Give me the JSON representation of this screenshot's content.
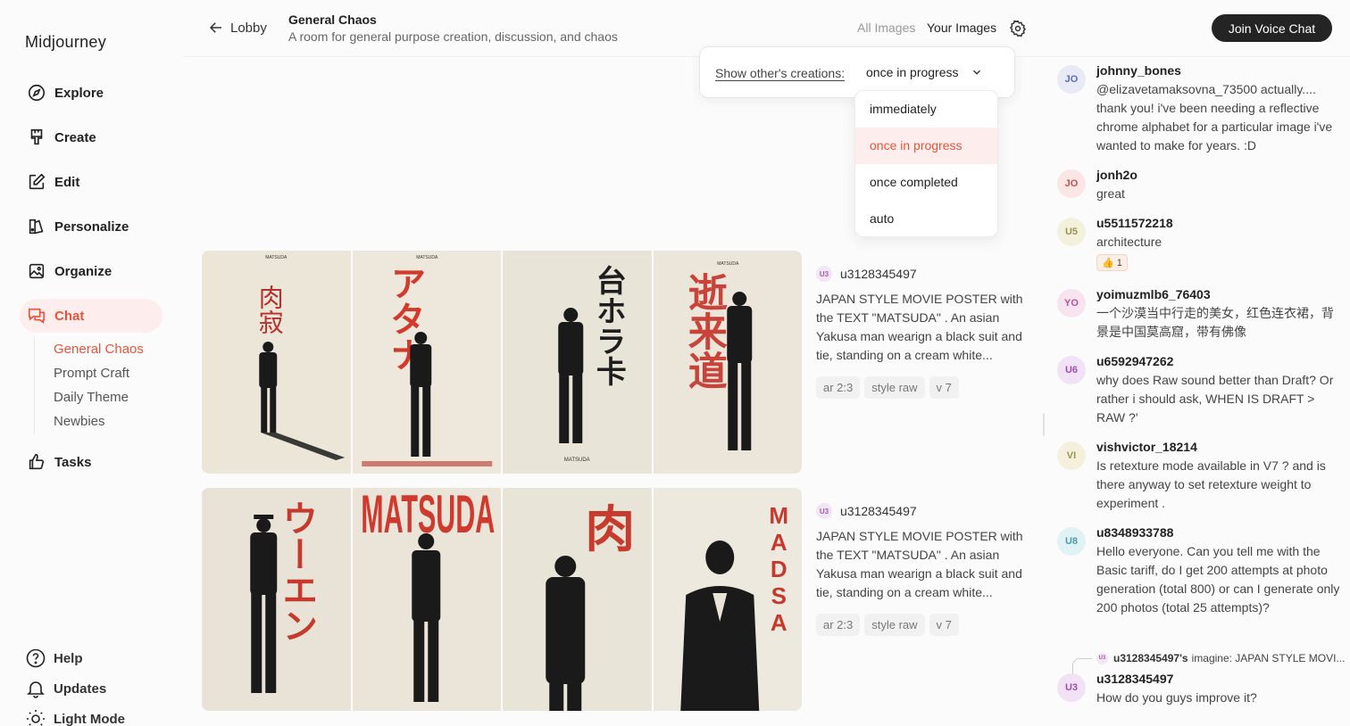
{
  "brand": "Midjourney",
  "nav": {
    "explore": "Explore",
    "create": "Create",
    "edit": "Edit",
    "personalize": "Personalize",
    "organize": "Organize",
    "chat": "Chat",
    "tasks": "Tasks"
  },
  "rooms": [
    "General Chaos",
    "Prompt Craft",
    "Daily Theme",
    "Newbies"
  ],
  "footer": {
    "help": "Help",
    "updates": "Updates",
    "light_mode": "Light Mode"
  },
  "header": {
    "back": "Lobby",
    "title": "General Chaos",
    "description": "A room for general purpose creation, discussion, and chaos",
    "all_images": "All Images",
    "your_images": "Your Images",
    "join": "Join Voice Chat"
  },
  "popover": {
    "label": "Show other's creations:",
    "selected": "once in progress",
    "options": [
      "immediately",
      "once in progress",
      "once completed",
      "auto"
    ]
  },
  "feed": [
    {
      "user": "u3128345497",
      "avatar": "U3",
      "prompt": "JAPAN STYLE MOVIE POSTER with the TEXT \"MATSUDA\" . An asian Yakusa man wearign a black suit and tie, standing on a cream white...",
      "tags": [
        "ar 2:3",
        "style raw",
        "v 7"
      ]
    },
    {
      "user": "u3128345497",
      "avatar": "U3",
      "prompt": "JAPAN STYLE MOVIE POSTER with the TEXT \"MATSUDA\" . An asian Yakusa man wearign a black suit and tie, standing on a cream white...",
      "tags": [
        "ar 2:3",
        "style raw",
        "v 7"
      ]
    }
  ],
  "posters": {
    "row1": [
      {
        "top": "MATSUDA",
        "big": "肉寂",
        "bottom": ""
      },
      {
        "top": "MATSUDA",
        "big": "アタナ",
        "bottom": ""
      },
      {
        "top": "",
        "big": "台ホラ卡",
        "bottom": "MATSUDA"
      },
      {
        "top": "MATSUDA",
        "big": "逝来道",
        "bottom": ""
      }
    ],
    "row2": [
      {
        "top": "",
        "big": "ウーエン",
        "bottom": ""
      },
      {
        "top": "",
        "big": "MATSUDA",
        "bottom": ""
      },
      {
        "top": "",
        "big": "肉",
        "bottom": ""
      },
      {
        "top": "",
        "big": "MADSA",
        "bottom": ""
      }
    ]
  },
  "chat": [
    {
      "avatar": "JO",
      "user": "johnny_bones",
      "text": "@elizavetamaksovna_73500 actually.... thank you! i've been needing a reflective chrome alphabet for a particular image i've wanted to make for years. :D"
    },
    {
      "avatar": "JO",
      "user": "jonh2o",
      "text": "great"
    },
    {
      "avatar": "U5",
      "user": "u5511572218",
      "text": "architecture",
      "reaction": "👍 1"
    },
    {
      "avatar": "YO",
      "user": "yoimuzmlb6_76403",
      "text": "一个沙漠当中行走的美女，红色连衣裙，背景是中国莫高窟，带有佛像"
    },
    {
      "avatar": "U6",
      "user": "u6592947262",
      "text": "why does Raw sound better than Draft? Or rather i should ask, WHEN IS DRAFT > RAW ?'"
    },
    {
      "avatar": "VI",
      "user": "vishvictor_18214",
      "text": "Is retexture mode available in V7 ? and is there anyway to set retexture weight to experiment ."
    },
    {
      "avatar": "U8",
      "user": "u8348933788",
      "text": "Hello everyone. Can you tell me with the Basic tariff, do I get 200 attempts at photo generation (total 800) or can I generate only 200 photos (total 25 attempts)?"
    },
    {
      "avatar": "U3",
      "user": "u3128345497",
      "text": "How do you guys improve it?"
    }
  ],
  "reply": {
    "avatar": "U3",
    "user": "u3128345497's",
    "text": "imagine: JAPAN STYLE MOVI..."
  },
  "colors": {
    "accent": "#e5553b",
    "accent_bg": "#fdeeed",
    "button_dark": "#242424"
  }
}
